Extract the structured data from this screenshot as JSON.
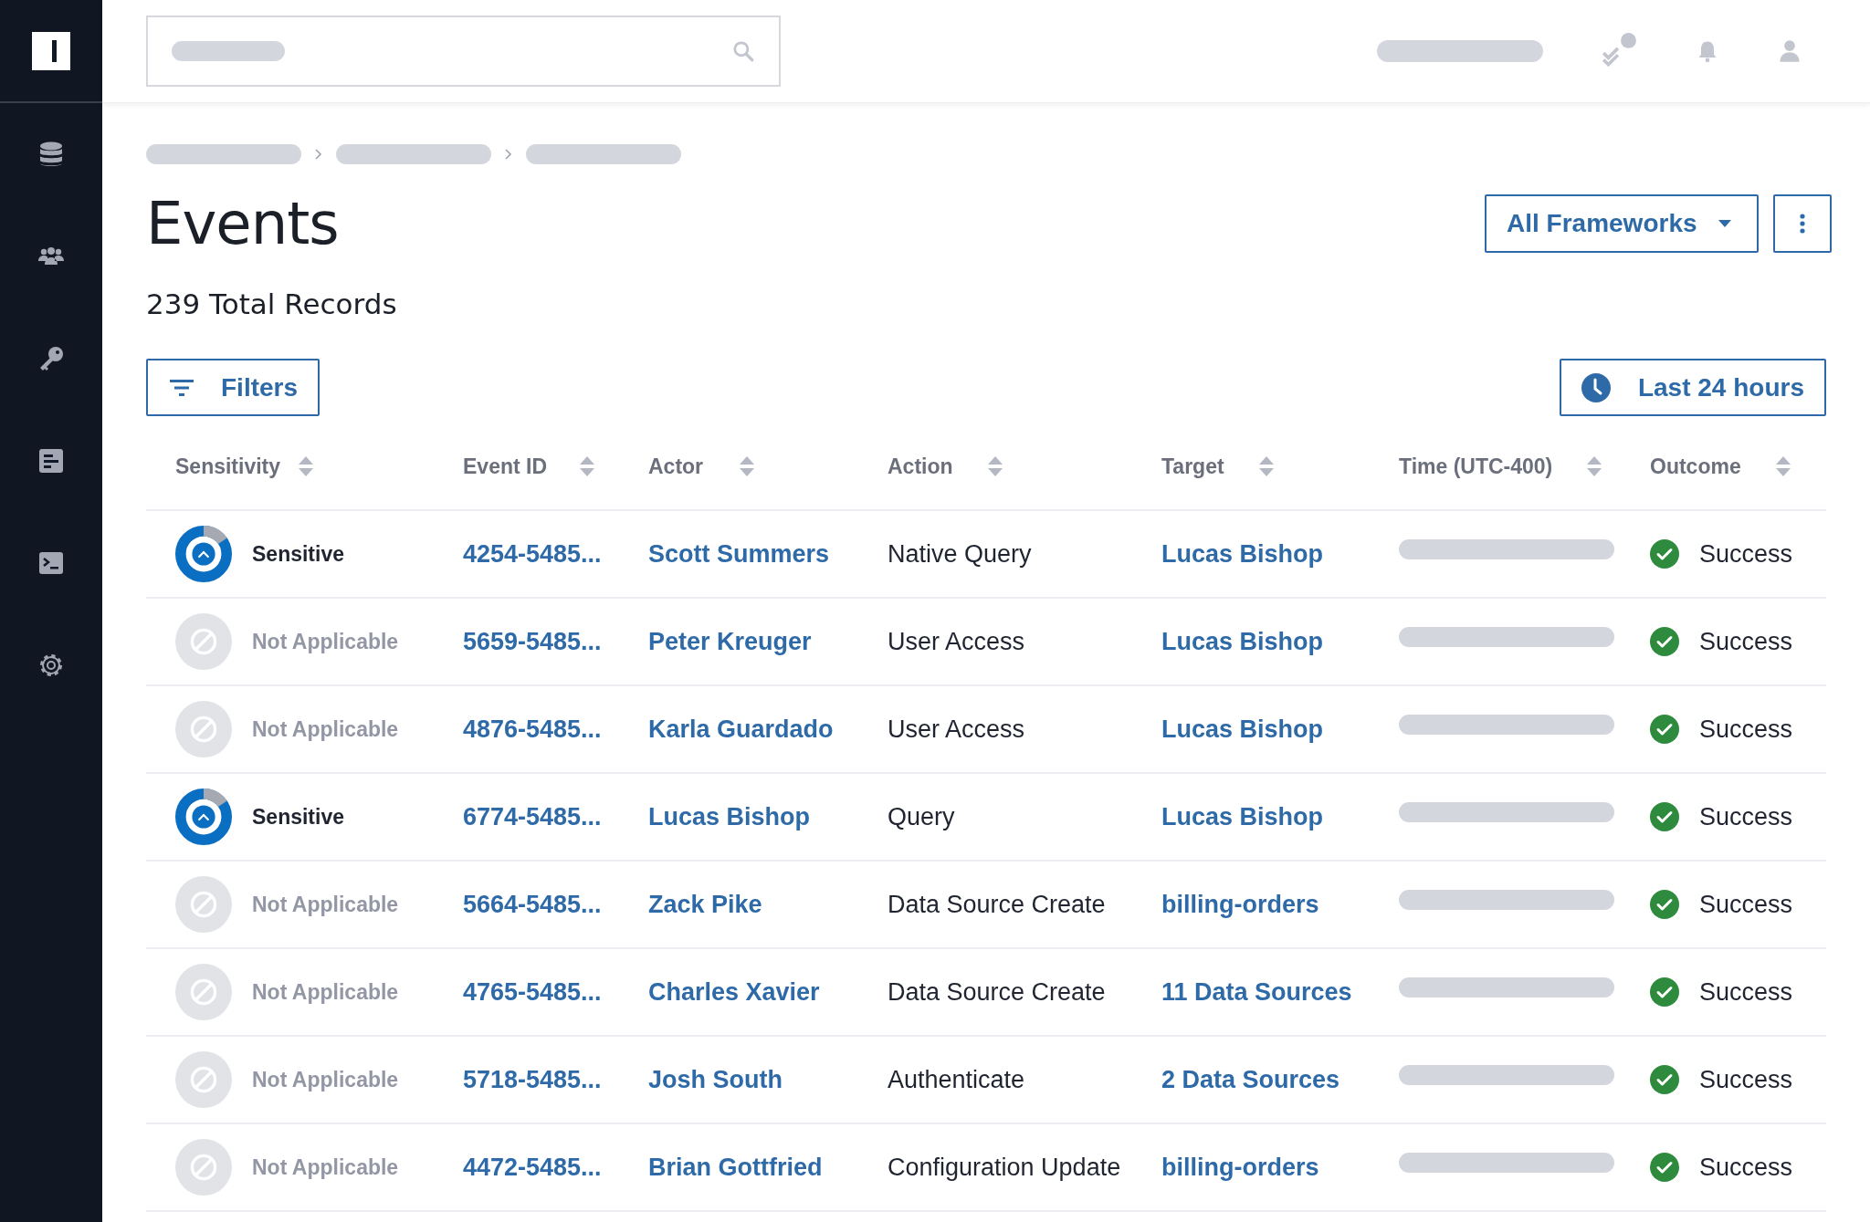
{
  "page": {
    "title": "Events",
    "record_count": "239 Total Records"
  },
  "framework_dropdown": {
    "label": "All Frameworks"
  },
  "filters_button": {
    "label": "Filters"
  },
  "time_range_button": {
    "label": "Last 24 hours"
  },
  "table": {
    "columns": [
      "Sensitivity",
      "Event ID",
      "Actor",
      "Action",
      "Target",
      "Time (UTC-400)",
      "Outcome"
    ],
    "rows": [
      {
        "sensitivity": {
          "kind": "sensitive",
          "label": "Sensitive"
        },
        "event_id": "4254-5485...",
        "actor": "Scott Summers",
        "action": "Native Query",
        "target": "Lucas Bishop",
        "outcome": {
          "kind": "success",
          "label": "Success"
        }
      },
      {
        "sensitivity": {
          "kind": "not_applicable",
          "label": "Not Applicable"
        },
        "event_id": "5659-5485...",
        "actor": "Peter Kreuger",
        "action": "User Access",
        "target": "Lucas Bishop",
        "outcome": {
          "kind": "success",
          "label": "Success"
        }
      },
      {
        "sensitivity": {
          "kind": "not_applicable",
          "label": "Not Applicable"
        },
        "event_id": "4876-5485...",
        "actor": "Karla Guardado",
        "action": "User Access",
        "target": "Lucas Bishop",
        "outcome": {
          "kind": "success",
          "label": "Success"
        }
      },
      {
        "sensitivity": {
          "kind": "sensitive",
          "label": "Sensitive"
        },
        "event_id": "6774-5485...",
        "actor": "Lucas Bishop",
        "action": "Query",
        "target": "Lucas Bishop",
        "outcome": {
          "kind": "success",
          "label": "Success"
        }
      },
      {
        "sensitivity": {
          "kind": "not_applicable",
          "label": "Not Applicable"
        },
        "event_id": "5664-5485...",
        "actor": "Zack Pike",
        "action": "Data Source Create",
        "target": "billing-orders",
        "outcome": {
          "kind": "success",
          "label": "Success"
        }
      },
      {
        "sensitivity": {
          "kind": "not_applicable",
          "label": "Not Applicable"
        },
        "event_id": "4765-5485...",
        "actor": "Charles Xavier",
        "action": "Data Source Create",
        "target": "11 Data Sources",
        "outcome": {
          "kind": "success",
          "label": "Success"
        }
      },
      {
        "sensitivity": {
          "kind": "not_applicable",
          "label": "Not Applicable"
        },
        "event_id": "5718-5485...",
        "actor": "Josh South",
        "action": "Authenticate",
        "target": "2 Data Sources",
        "outcome": {
          "kind": "success",
          "label": "Success"
        }
      },
      {
        "sensitivity": {
          "kind": "not_applicable",
          "label": "Not Applicable"
        },
        "event_id": "4472-5485...",
        "actor": "Brian Gottfried",
        "action": "Configuration Update",
        "target": "billing-orders",
        "outcome": {
          "kind": "success",
          "label": "Success"
        }
      }
    ]
  }
}
